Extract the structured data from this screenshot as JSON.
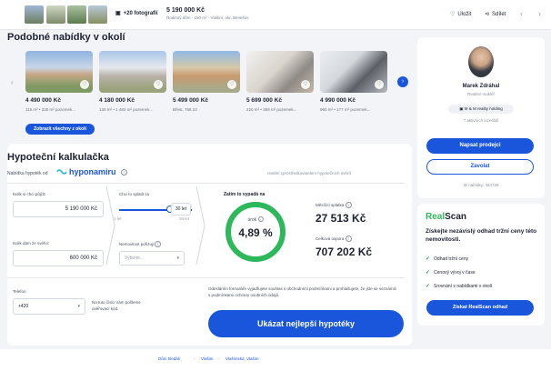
{
  "topbar": {
    "photos_label": "+20 fotografií",
    "price": "5 190 000 Kč",
    "address": "Rodinný dům · 160 m² · Vlašim, okr. Benešov",
    "save_label": "Uložit",
    "share_label": "Sdílet"
  },
  "similar": {
    "title": "Podobné nabídky v okolí",
    "show_all_label": "Zobrazit všechny z okolí",
    "items": [
      {
        "price": "4 490 000 Kč",
        "desc": "115 m² • 330 m² pozemek..."
      },
      {
        "price": "4 180 000 Kč",
        "desc": "130 m² • 1 482 m² pozemek..."
      },
      {
        "price": "5 499 000 Kč",
        "desc": "Břest, 768 23"
      },
      {
        "price": "5 699 000 Kč",
        "desc": "220 m² • 359 m² pozemek..."
      },
      {
        "price": "4 990 000 Kč",
        "desc": "960 m² • 177 m² pozemek..."
      }
    ]
  },
  "calc": {
    "title": "Hypoteční kalkulačka",
    "offer_label": "Nabídka hypoték od",
    "brand": "hyponamiru",
    "disclaimer": "realitní zprostředkovatelem hypotečních úvěrů",
    "borrow_label": "Kolik si chci půjčit:",
    "borrow_value": "5 190 000 Kč",
    "years_label": "Chci to splatit za",
    "years_value": "30 let",
    "years_min": "1 let",
    "years_max": "30 let",
    "own_label": "Kolik dám ze svého:",
    "own_value": "600 000 Kč",
    "property_label": "Nemovitost pořizuji",
    "property_placeholder": "Vyberte...",
    "rate_title": "Zatím to vypadá na",
    "rate_caption": "úrok",
    "rate_value": "4,89 %",
    "monthly_label": "Měsíční splátka",
    "monthly_value": "27 513 Kč",
    "overpay_label": "Celková úspora",
    "overpay_value": "707 202 Kč",
    "phone_label": "Telefon",
    "phone_prefix": "+420",
    "phone_hint": "Na tuto číslo Vám pošleme ověřovací kód.",
    "consent_text": "Odesláním formuláře vyjadřujete souhlas s obchodními podmínkami a prohlašujete, že jste se seznámili s podmínkami ochrany osobních údajů.",
    "cta_label": "Ukázat nejlepší hypotéky"
  },
  "agent": {
    "name": "Marek Zdráhal",
    "role": "Realitní makléř",
    "company": "M & M reality holding",
    "listings": "7 aktivních inzerátů",
    "message_label": "Napsat prodejci",
    "call_label": "Zavolat",
    "listing_id": "ID nabídky: 454728"
  },
  "realscan": {
    "brand_a": "Real",
    "brand_b": "Scan",
    "headline": "Získejte nezávislý odhad tržní ceny této nemovitosti.",
    "features": [
      "Odhad tržní ceny",
      "Cenový vývoj v čase",
      "Srovnání s nabídkami v okolí"
    ],
    "cta_label": "Získat RealScan odhad"
  },
  "breadcrumbs": [
    "Dům hledáš",
    "Vlašim",
    "Vlašimská, Vlašim"
  ],
  "colors": {
    "accent": "#1a56db",
    "green": "#2eb85c"
  }
}
